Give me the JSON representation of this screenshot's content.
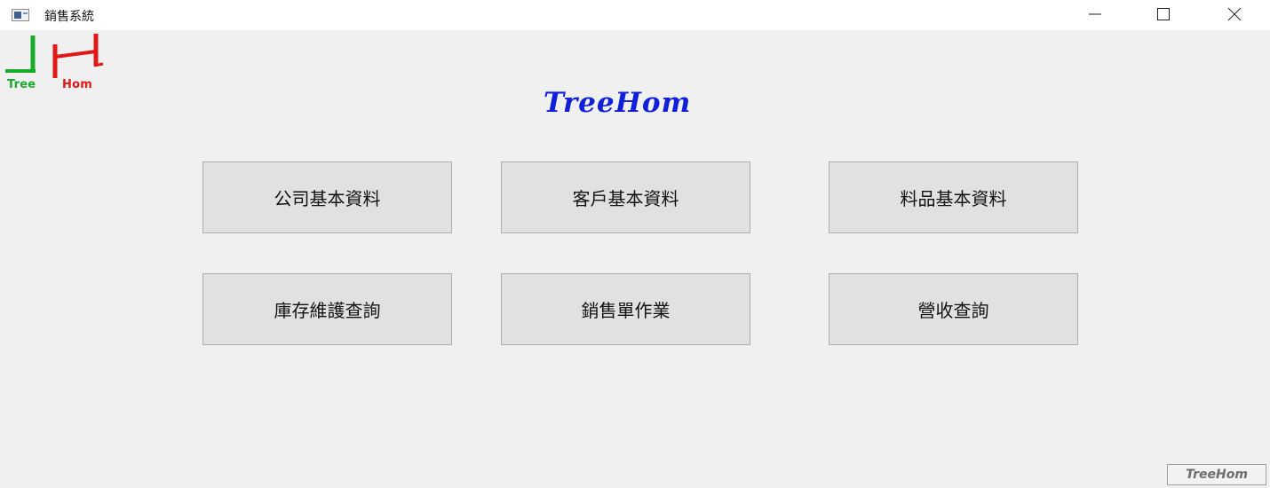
{
  "window": {
    "title": "銷售系統",
    "controls": {
      "minimize": "minimize-icon",
      "maximize": "maximize-icon",
      "close": "close-icon"
    }
  },
  "logo": {
    "text_left": "Tree",
    "text_right": "Hom",
    "colors": {
      "green": "#1aaa2a",
      "red": "#e01818"
    }
  },
  "brand": {
    "title": "TreeHom",
    "color": "#1020d8"
  },
  "menu": {
    "buttons": [
      {
        "label": "公司基本資料"
      },
      {
        "label": "客戶基本資料"
      },
      {
        "label": "料品基本資料"
      },
      {
        "label": "庫存維護查詢"
      },
      {
        "label": "銷售單作業"
      },
      {
        "label": "營收查詢"
      }
    ]
  },
  "footer": {
    "badge": "TreeHom"
  }
}
